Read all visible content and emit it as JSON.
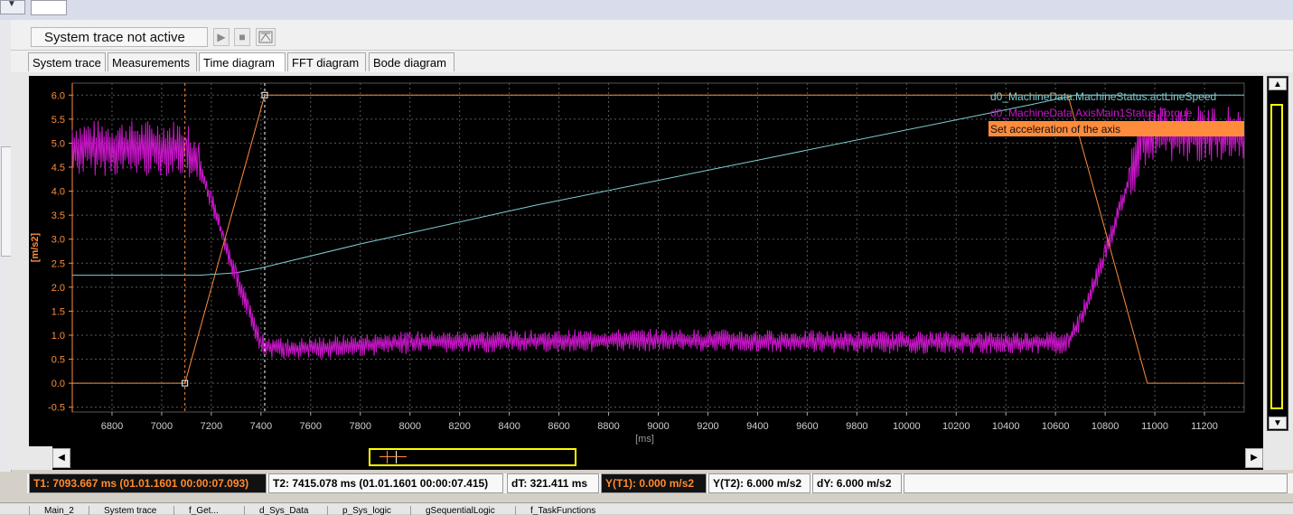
{
  "toolbar": {
    "status": "System trace not active",
    "play_icon": "play-icon",
    "stop_icon": "stop-icon",
    "export_icon": "export-icon"
  },
  "tabs": [
    {
      "label": "System trace"
    },
    {
      "label": "Measurements"
    },
    {
      "label": "Time diagram",
      "active": true
    },
    {
      "label": "FFT diagram"
    },
    {
      "label": "Bode diagram"
    }
  ],
  "colors": {
    "speed": "#7ecfd2",
    "torque": "#cc16cc",
    "accel": "#ff8c3c",
    "axis_text": "#ff8c3c",
    "grid": "#5a5a5a"
  },
  "chart_data": {
    "type": "line",
    "title": "",
    "xlabel": "[ms]",
    "ylabel": "[m/s2]",
    "xlim": [
      6640,
      11360
    ],
    "ylim": [
      -0.6,
      6.25
    ],
    "x_ticks": [
      6800,
      7000,
      7200,
      7400,
      7600,
      7800,
      8000,
      8200,
      8400,
      8600,
      8800,
      9000,
      9200,
      9400,
      9600,
      9800,
      10000,
      10200,
      10400,
      10600,
      10800,
      11000,
      11200
    ],
    "y_ticks": [
      -0.5,
      0.0,
      0.5,
      1.0,
      1.5,
      2.0,
      2.5,
      3.0,
      3.5,
      4.0,
      4.5,
      5.0,
      5.5,
      6.0
    ],
    "y_tick_labels": [
      "-0.5",
      "0.0",
      "0.5",
      "1.0",
      "1.5",
      "2.0",
      "2.5",
      "3.0",
      "3.5",
      "4.0",
      "4.5",
      "5.0",
      "5.5",
      "6.0"
    ],
    "grid": true,
    "legend_position": "top-right",
    "series": [
      {
        "name": "d0_MachineData.MachineStatus.actLineSpeed",
        "color": "#7ecfd2",
        "x": [
          6640,
          7150,
          7300,
          7400,
          7800,
          8500,
          9500,
          10500,
          10680,
          11360
        ],
        "y": [
          2.25,
          2.25,
          2.3,
          2.4,
          2.9,
          3.7,
          4.75,
          5.8,
          6.0,
          6.0
        ]
      },
      {
        "name": "d0_MachineData.AxisMain1Status.Torque",
        "color": "#cc16cc",
        "x": [
          6640,
          7100,
          7150,
          7200,
          7250,
          7300,
          7350,
          7400,
          7500,
          8000,
          9000,
          10000,
          10650,
          10700,
          10800,
          10900,
          10950,
          11000,
          11360
        ],
        "y": [
          4.9,
          4.9,
          4.5,
          3.8,
          3.0,
          2.2,
          1.5,
          0.8,
          0.7,
          0.85,
          0.9,
          0.85,
          0.85,
          1.3,
          2.7,
          4.3,
          5.0,
          5.2,
          5.2
        ]
      },
      {
        "name": "Set acceleration of the axis",
        "color": "#ff8c3c",
        "x": [
          6640,
          7093.667,
          7415.078,
          10650,
          10970,
          11360
        ],
        "y": [
          0.0,
          0.0,
          6.0,
          6.0,
          0.0,
          0.0
        ]
      }
    ],
    "cursors": [
      {
        "label": "T1",
        "x": 7093.667,
        "y": 0.0
      },
      {
        "label": "T2",
        "x": 7415.078,
        "y": 6.0
      }
    ]
  },
  "status_bar": {
    "t1": "T1: 7093.667 ms (01.01.1601 00:00:07.093)",
    "t2": "T2: 7415.078 ms (01.01.1601 00:00:07.415)",
    "dt": "dT: 321.411 ms",
    "yt1": "Y(T1):  0.000 m/s2",
    "yt2": "Y(T2): 6.000 m/s2",
    "dy": "dY: 6.000 m/s2"
  },
  "bottom_tabs": [
    "Main_2",
    "System trace",
    "f_Get...",
    "d_Sys_Data",
    "p_Sys_logic",
    "gSequentialLogic",
    "f_TaskFunctions"
  ]
}
